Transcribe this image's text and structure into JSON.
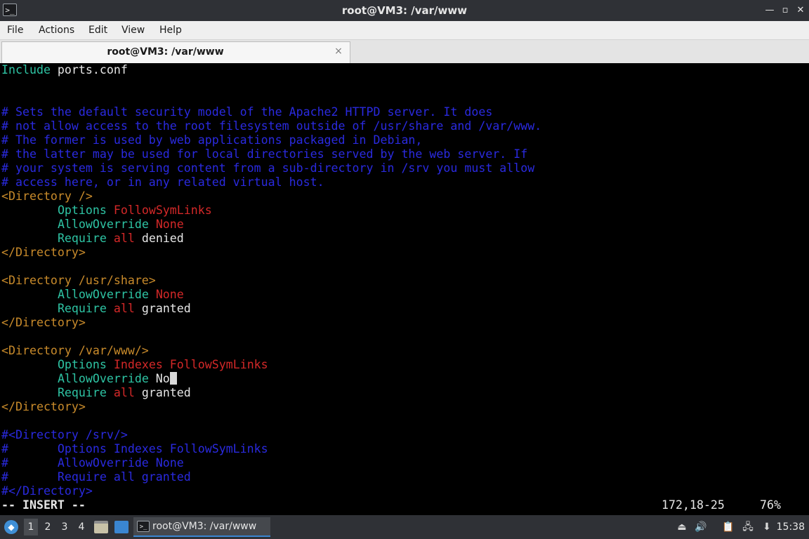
{
  "window": {
    "title": "root@VM3: /var/www",
    "app_icon": "terminal-icon",
    "controls": {
      "minimize": "—",
      "maximize": "▫",
      "close": "✕"
    }
  },
  "menu": {
    "items": [
      "File",
      "Actions",
      "Edit",
      "View",
      "Help"
    ]
  },
  "tab": {
    "label": "root@VM3: /var/www",
    "close_icon": "×"
  },
  "editor": {
    "lines": [
      [
        {
          "t": "Include",
          "c": "kw"
        },
        {
          "t": " ports.conf",
          "c": "txt"
        }
      ],
      [],
      [],
      [
        {
          "t": "# Sets the default security model of the Apache2 HTTPD server. It does",
          "c": "cmt"
        }
      ],
      [
        {
          "t": "# not allow access to the root filesystem outside of /usr/share and /var/www.",
          "c": "cmt"
        }
      ],
      [
        {
          "t": "# The former is used by web applications packaged in Debian,",
          "c": "cmt"
        }
      ],
      [
        {
          "t": "# the latter may be used for local directories served by the web server. If",
          "c": "cmt"
        }
      ],
      [
        {
          "t": "# your system is serving content from a sub-directory in /srv you must allow",
          "c": "cmt"
        }
      ],
      [
        {
          "t": "# access here, or in any related virtual host.",
          "c": "cmt"
        }
      ],
      [
        {
          "t": "<Directory />",
          "c": "tag"
        }
      ],
      [
        {
          "t": "        ",
          "c": "txt"
        },
        {
          "t": "Options",
          "c": "kw"
        },
        {
          "t": " ",
          "c": "txt"
        },
        {
          "t": "FollowSymLinks",
          "c": "red"
        }
      ],
      [
        {
          "t": "        ",
          "c": "txt"
        },
        {
          "t": "AllowOverride",
          "c": "kw"
        },
        {
          "t": " ",
          "c": "txt"
        },
        {
          "t": "None",
          "c": "red"
        }
      ],
      [
        {
          "t": "        ",
          "c": "txt"
        },
        {
          "t": "Require",
          "c": "kw"
        },
        {
          "t": " ",
          "c": "txt"
        },
        {
          "t": "all",
          "c": "red"
        },
        {
          "t": " denied",
          "c": "txt"
        }
      ],
      [
        {
          "t": "</Directory>",
          "c": "tag"
        }
      ],
      [],
      [
        {
          "t": "<Directory /usr/share>",
          "c": "tag"
        }
      ],
      [
        {
          "t": "        ",
          "c": "txt"
        },
        {
          "t": "AllowOverride",
          "c": "kw"
        },
        {
          "t": " ",
          "c": "txt"
        },
        {
          "t": "None",
          "c": "red"
        }
      ],
      [
        {
          "t": "        ",
          "c": "txt"
        },
        {
          "t": "Require",
          "c": "kw"
        },
        {
          "t": " ",
          "c": "txt"
        },
        {
          "t": "all",
          "c": "red"
        },
        {
          "t": " granted",
          "c": "txt"
        }
      ],
      [
        {
          "t": "</Directory>",
          "c": "tag"
        }
      ],
      [],
      [
        {
          "t": "<Directory /var/www/>",
          "c": "tag"
        }
      ],
      [
        {
          "t": "        ",
          "c": "txt"
        },
        {
          "t": "Options",
          "c": "kw"
        },
        {
          "t": " ",
          "c": "txt"
        },
        {
          "t": "Indexes FollowSymLinks",
          "c": "red"
        }
      ],
      [
        {
          "t": "        ",
          "c": "txt"
        },
        {
          "t": "AllowOverride",
          "c": "kw"
        },
        {
          "t": " No",
          "c": "txt"
        },
        {
          "t": "",
          "c": "cursor"
        }
      ],
      [
        {
          "t": "        ",
          "c": "txt"
        },
        {
          "t": "Require",
          "c": "kw"
        },
        {
          "t": " ",
          "c": "txt"
        },
        {
          "t": "all",
          "c": "red"
        },
        {
          "t": " granted",
          "c": "txt"
        }
      ],
      [
        {
          "t": "</Directory>",
          "c": "tag"
        }
      ],
      [],
      [
        {
          "t": "#<Directory /srv/>",
          "c": "cmt"
        }
      ],
      [
        {
          "t": "#       Options Indexes FollowSymLinks",
          "c": "cmt"
        }
      ],
      [
        {
          "t": "#       AllowOverride None",
          "c": "cmt"
        }
      ],
      [
        {
          "t": "#       Require all granted",
          "c": "cmt"
        }
      ],
      [
        {
          "t": "#</Directory>",
          "c": "cmt"
        }
      ]
    ],
    "mode": "-- INSERT --",
    "position": "172,18-25",
    "percent": "76%"
  },
  "taskbar": {
    "start_icon": "menu-logo-icon",
    "workspaces": [
      "1",
      "2",
      "3",
      "4"
    ],
    "active_workspace": "1",
    "launchers": [
      "file-manager-icon",
      "show-desktop-icon"
    ],
    "task_label": "root@VM3: /var/www",
    "tray_icons": [
      "eject-icon",
      "volume-icon",
      "clipboard-icon",
      "network-icon",
      "update-icon"
    ],
    "clock": "15:38"
  },
  "colors": {
    "keyword": "#2ec4a4",
    "comment": "#2a2ae0",
    "tag": "#c98b2b",
    "value": "#d42828",
    "text": "#e6e6e6",
    "background": "#000000",
    "chrome": "#2f3136"
  }
}
